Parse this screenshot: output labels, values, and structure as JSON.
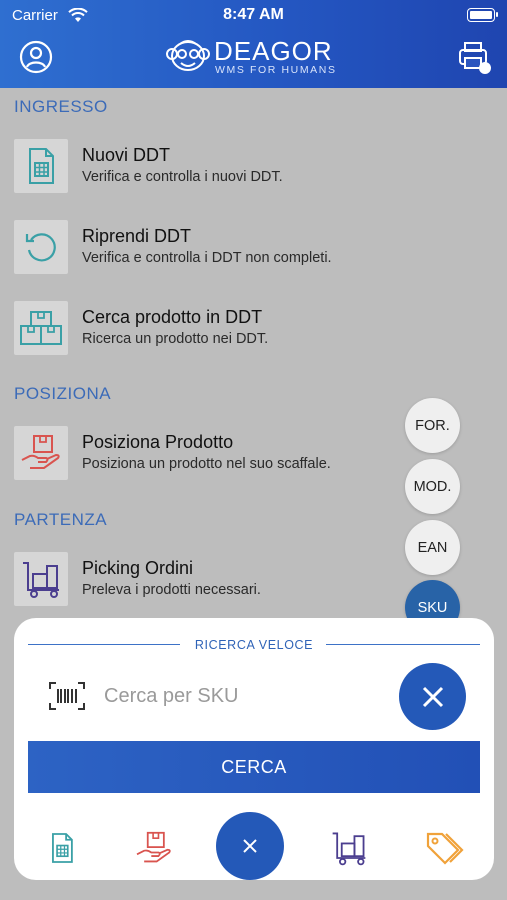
{
  "status_bar": {
    "carrier": "Carrier",
    "time": "8:47 AM"
  },
  "header": {
    "brand_name": "DEAGOR",
    "brand_tagline": "WMS FOR HUMANS"
  },
  "sections": {
    "ingresso": "INGRESSO",
    "posiziona": "POSIZIONA",
    "partenza": "PARTENZA"
  },
  "items": [
    {
      "title": "Nuovi DDT",
      "subtitle": "Verifica e controlla i nuovi DDT.",
      "icon": "document-icon"
    },
    {
      "title": "Riprendi DDT",
      "subtitle": "Verifica e controlla i DDT non completi.",
      "icon": "undo-icon"
    },
    {
      "title": "Cerca prodotto in DDT",
      "subtitle": "Ricerca un prodotto nei DDT.",
      "icon": "boxes-icon"
    },
    {
      "title": "Posiziona Prodotto",
      "subtitle": "Posiziona un prodotto nel suo scaffale.",
      "icon": "hand-box-icon"
    },
    {
      "title": "Picking Ordini",
      "subtitle": "Preleva i prodotti necessari.",
      "icon": "cart-icon"
    }
  ],
  "search_modes": [
    "FOR.",
    "MOD.",
    "EAN",
    "SKU"
  ],
  "active_search_mode": "SKU",
  "quick_search": {
    "label": "RICERCA VELOCE",
    "placeholder": "Cerca per SKU",
    "value": "",
    "button": "CERCA"
  },
  "colors": {
    "brand": "#2459b8",
    "accent_teal": "#3aa0a6",
    "accent_red": "#d9544f",
    "accent_purple": "#4b3e8f",
    "accent_orange": "#f0a23a"
  }
}
